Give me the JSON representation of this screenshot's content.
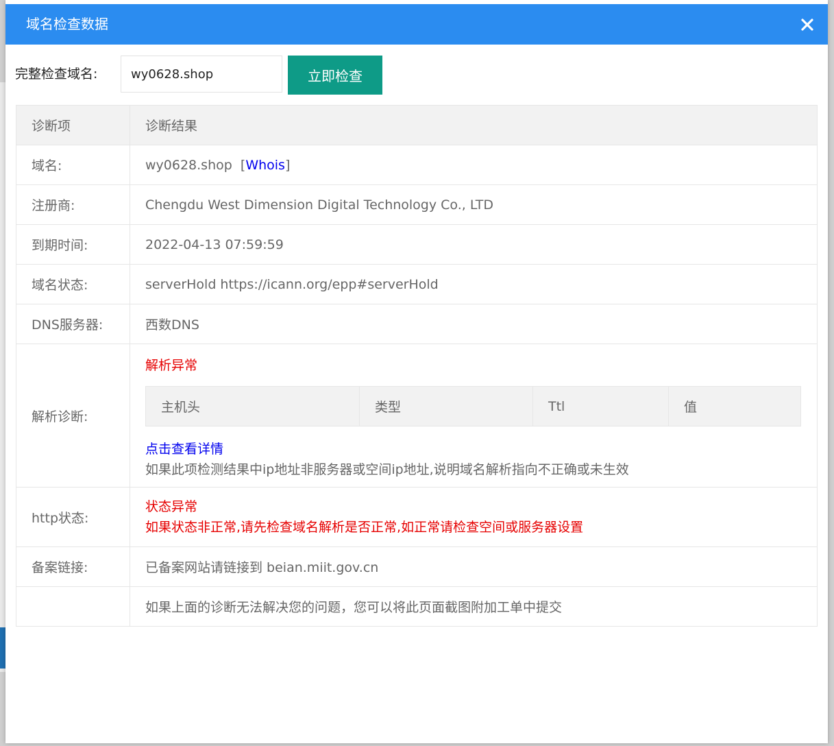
{
  "dialog": {
    "title": "域名检查数据",
    "close_label": "×"
  },
  "search": {
    "label": "完整检查域名:",
    "value": "wy0628.shop",
    "button": "立即检查"
  },
  "table": {
    "headers": [
      "诊断项",
      "诊断结果"
    ],
    "domain": {
      "label": "域名:",
      "value": "wy0628.shop",
      "whois": "Whois"
    },
    "registrar": {
      "label": "注册商:",
      "value": "Chengdu West Dimension Digital Technology Co., LTD"
    },
    "expiry": {
      "label": "到期时间:",
      "value": "2022-04-13 07:59:59"
    },
    "status": {
      "label": "域名状态:",
      "value": "serverHold https://icann.org/epp#serverHold"
    },
    "dns_server": {
      "label": "DNS服务器:",
      "value": "西数DNS"
    },
    "resolve": {
      "label": "解析诊断:",
      "status": "解析异常",
      "columns": [
        "主机头",
        "类型",
        "Ttl",
        "值"
      ],
      "detail_link": "点击查看详情",
      "note": "如果此项检测结果中ip地址非服务器或空间ip地址,说明域名解析指向不正确或未生效"
    },
    "http": {
      "label": "http状态:",
      "status": "状态异常",
      "note": "如果状态非正常,请先检查域名解析是否正常,如正常请检查空间或服务器设置"
    },
    "beian": {
      "label": "备案链接:",
      "text": "已备案网站请链接到 beian.miit.gov.cn"
    },
    "footer_note": "如果上面的诊断无法解决您的问题，您可以将此页面截图附加工单中提交"
  },
  "colors": {
    "header_bg": "#2b8cf0",
    "button_bg": "#0e9b87",
    "error": "#e60000",
    "ok": "#008000",
    "link": "#0000ee"
  }
}
